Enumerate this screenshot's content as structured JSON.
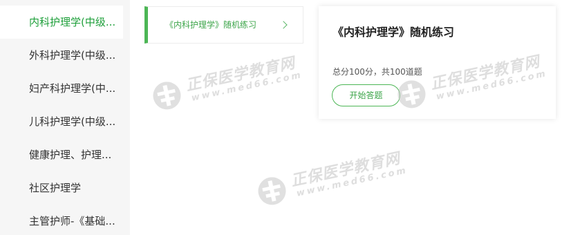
{
  "sidebar": {
    "items": [
      {
        "label": "内科护理学(中级..."
      },
      {
        "label": "外科护理学(中级..."
      },
      {
        "label": "妇产科护理学(中..."
      },
      {
        "label": "儿科护理学(中级..."
      },
      {
        "label": "健康护理、护理..."
      },
      {
        "label": "社区护理学"
      },
      {
        "label": "主管护师-《基础..."
      }
    ],
    "active_index": 0
  },
  "practice_list": {
    "items": [
      {
        "label": "《内科护理学》随机练习"
      }
    ]
  },
  "detail": {
    "title": "《内科护理学》随机练习",
    "summary": "总分100分，共100道题",
    "start_button": "开始答题"
  },
  "watermark": {
    "brand": "正保医学教育网",
    "url": "www.med66.com"
  },
  "colors": {
    "accent": "#4cb655",
    "accent_text": "#1e9f3a",
    "sidebar_bg": "#f6f6f6"
  },
  "icons": {
    "chevron": "chevron-right-icon",
    "watermark_logo": "med66-logo-icon"
  }
}
